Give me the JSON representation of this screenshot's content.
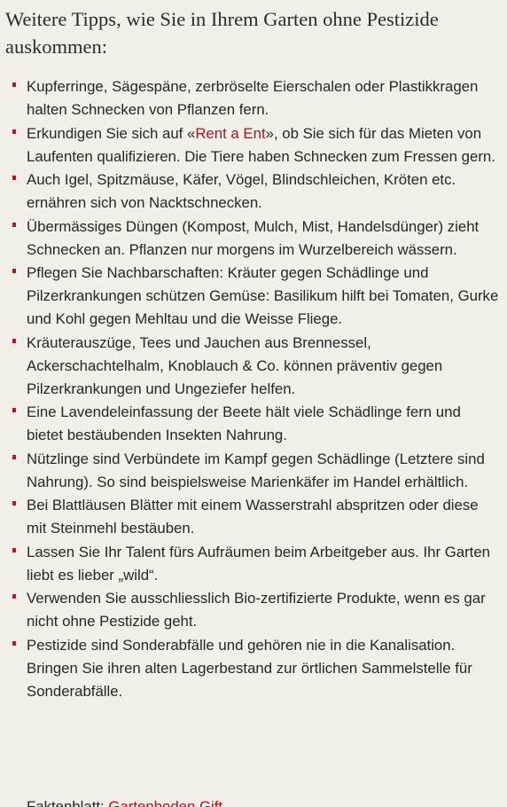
{
  "heading": "Weitere Tipps, wie Sie in Ihrem Garten ohne Pestizide auskommen:",
  "tips": [
    {
      "text": "Kupferringe, Sägespäne, zerbröselte Eierschalen oder Plastikkragen halten Schnecken von Pflanzen fern."
    },
    {
      "before": "Erkundigen Sie sich auf «",
      "link": "Rent a Ent",
      "after": "», ob Sie sich für das Mieten von Laufenten qualifizieren. Die Tiere haben Schnecken zum Fressen gern."
    },
    {
      "text": "Auch Igel, Spitzmäuse, Käfer, Vögel, Blindschleichen, Kröten etc. ernähren sich von Nacktschnecken."
    },
    {
      "text": "Übermässiges Düngen (Kompost, Mulch, Mist, Handelsdünger) zieht Schnecken an. Pflanzen nur morgens im Wurzelbereich wässern."
    },
    {
      "text": "Pflegen Sie Nachbarschaften: Kräuter gegen Schädlinge und Pilzerkrankungen schützen Gemüse: Basilikum hilft bei Tomaten, Gurke und Kohl gegen Mehltau und die Weisse Fliege."
    },
    {
      "text": "Kräuterauszüge, Tees und Jauchen aus Brennessel, Ackerschachtelhalm, Knoblauch & Co. können präventiv gegen Pilzerkrankungen und Ungeziefer helfen."
    },
    {
      "text": "Eine Lavendeleinfassung der Beete hält viele Schädlinge fern und bietet bestäubenden Insekten Nahrung."
    },
    {
      "text": "Nützlinge sind Verbündete im Kampf gegen Schädlinge (Letztere sind Nahrung). So sind beispielsweise Marienkäfer im Handel erhältlich."
    },
    {
      "text": "Bei Blattläusen Blätter mit einem Wasserstrahl abspritzen oder diese mit Steinmehl bestäuben."
    },
    {
      "text": "Lassen Sie Ihr Talent fürs Aufräumen beim Arbeitgeber aus. Ihr Garten liebt es lieber „wild“."
    },
    {
      "text": "Verwenden Sie ausschliesslich Bio-zertifizierte Produkte, wenn es gar nicht ohne Pestizide geht."
    },
    {
      "text": "Pestizide sind Sonderabfälle und gehören nie in die Kanalisation. Bringen Sie ihren alten Lagerbestand zur örtlichen Sammelstelle für Sonderabfälle."
    }
  ],
  "footer_partial": {
    "before": "Faktenblatt: ",
    "link": "Gartenboden Gift"
  },
  "colors": {
    "background": "#f2efe9",
    "text": "#262626",
    "accent": "#b01a24"
  }
}
